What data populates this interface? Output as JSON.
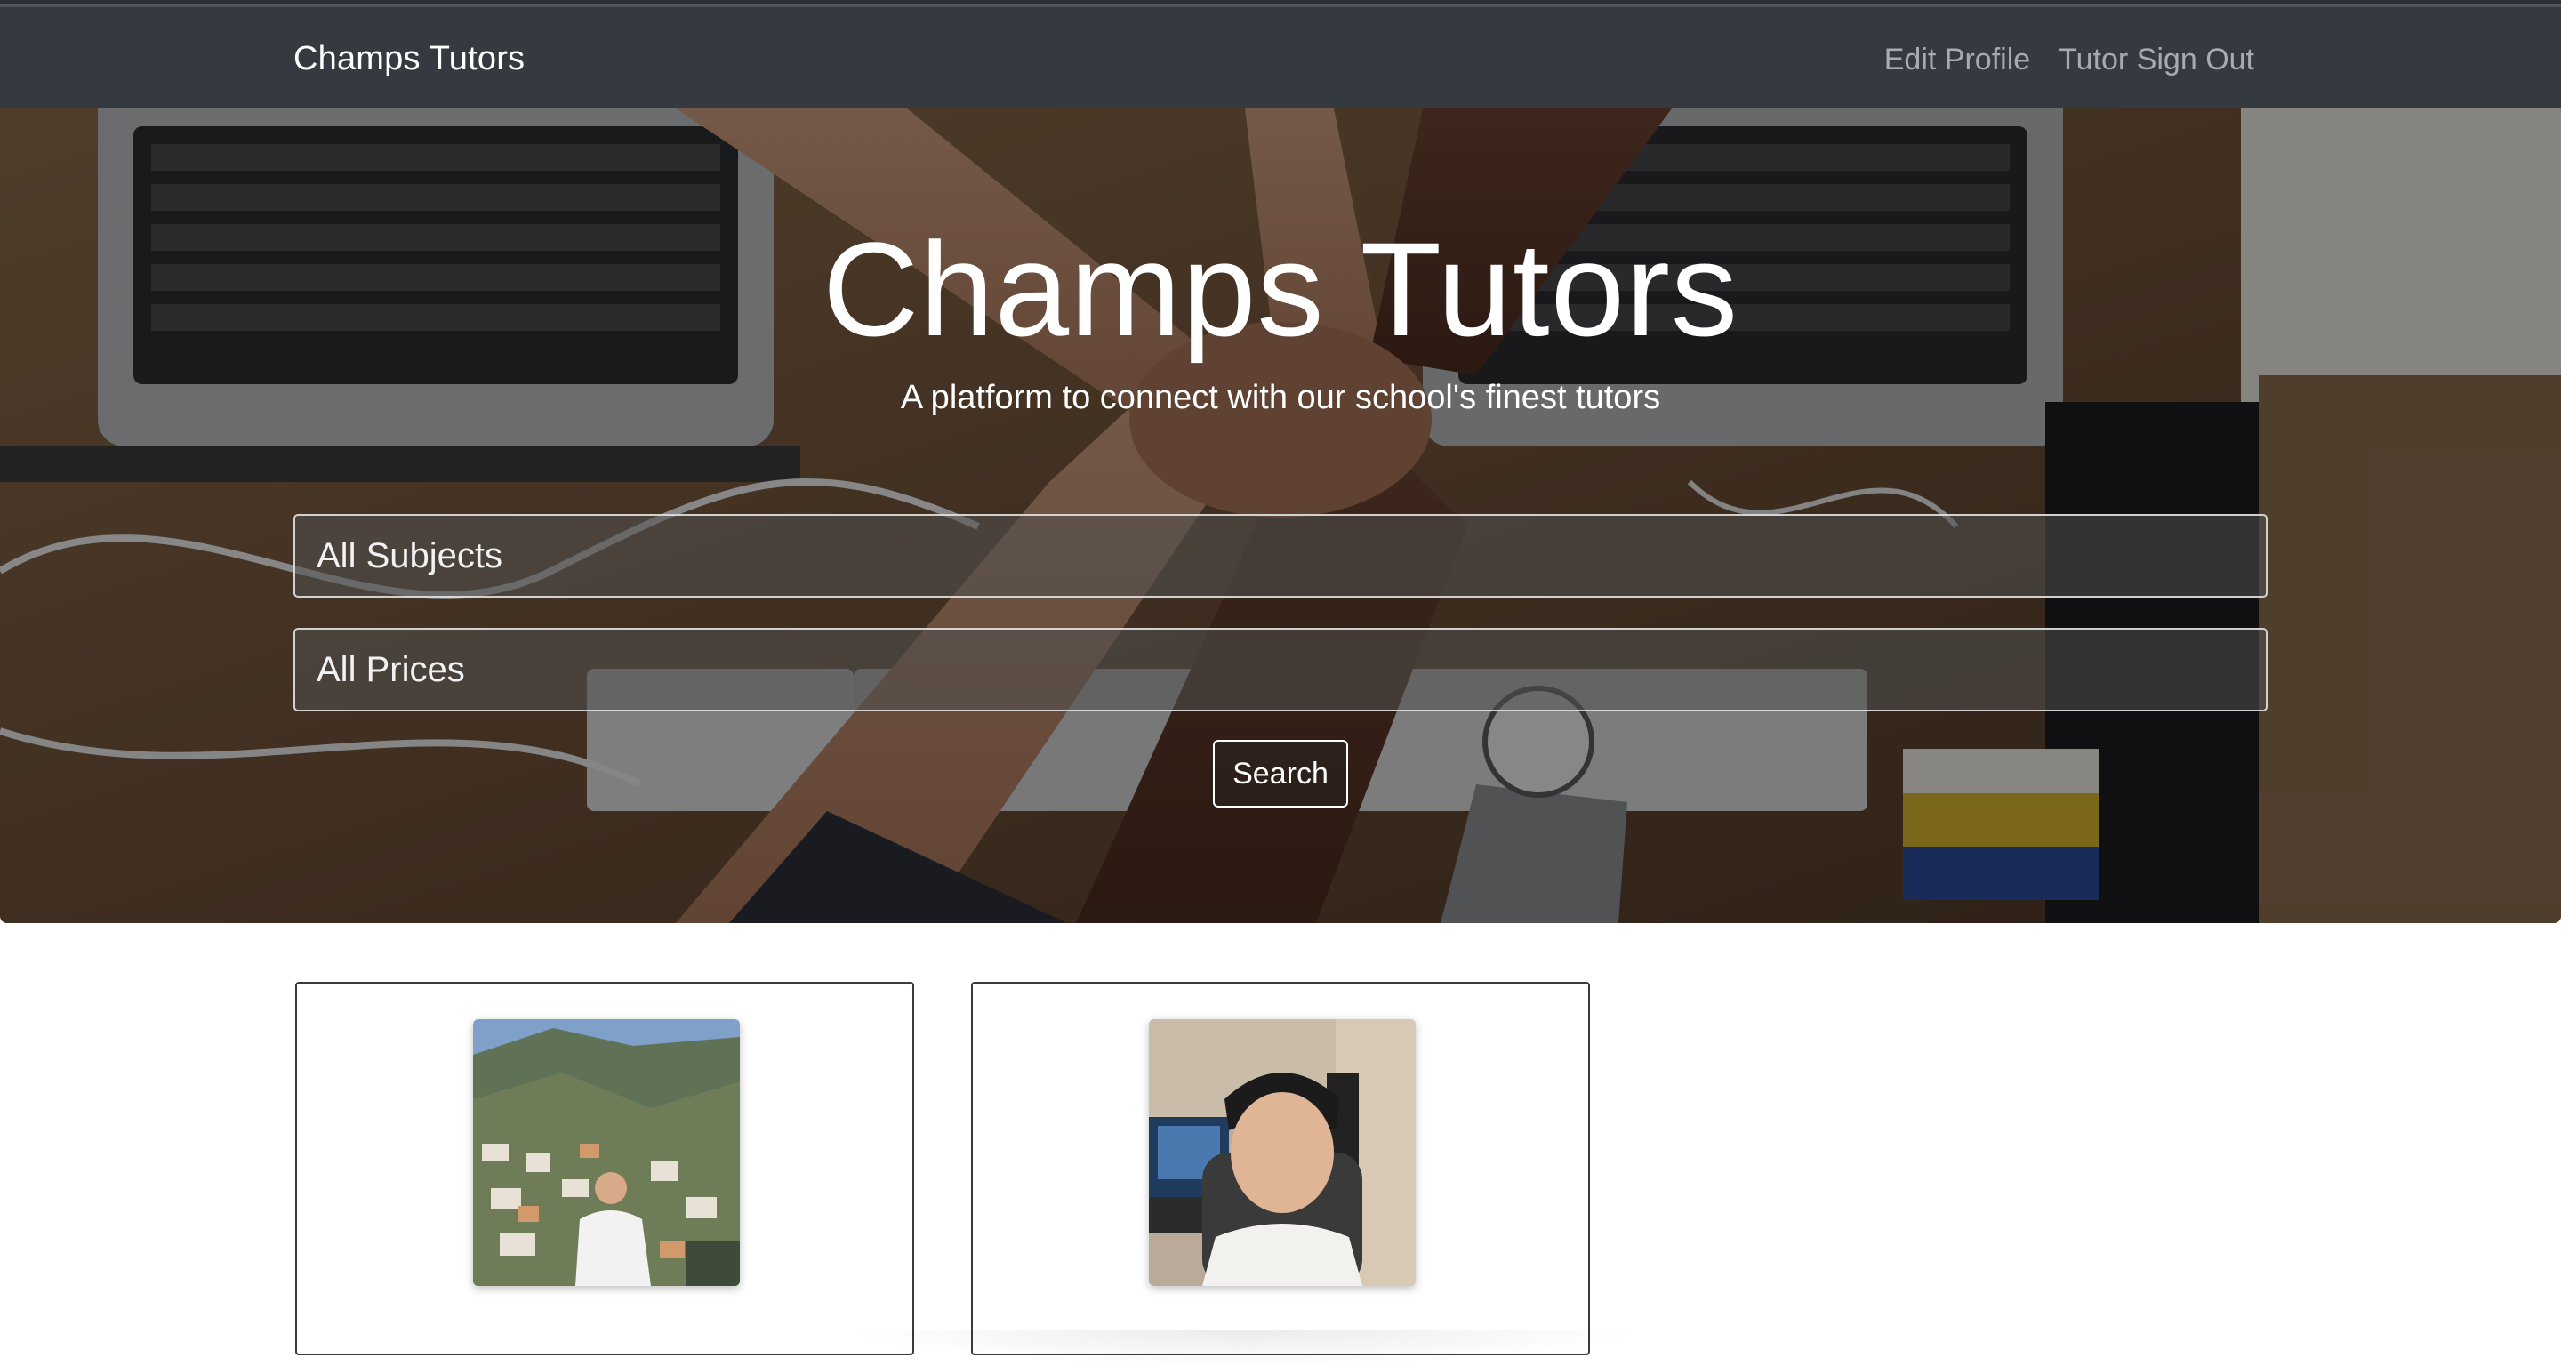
{
  "navbar": {
    "brand": "Champs Tutors",
    "links": {
      "edit_profile": "Edit Profile",
      "sign_out": "Tutor Sign Out"
    }
  },
  "hero": {
    "title": "Champs Tutors",
    "subtitle": "A platform to connect with our school's finest tutors",
    "subject_select": {
      "selected": "All Subjects"
    },
    "price_select": {
      "selected": "All Prices"
    },
    "search_label": "Search"
  },
  "colors": {
    "navbar_bg": "#343a40",
    "nav_link": "#a6abaf",
    "hero_text": "#ffffff"
  }
}
